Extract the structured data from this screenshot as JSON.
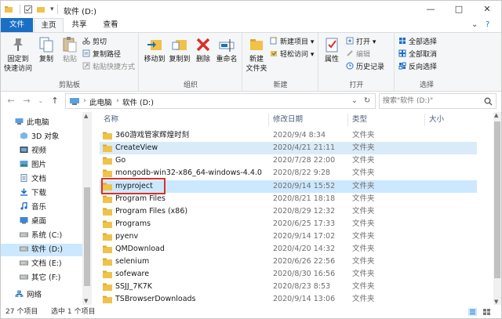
{
  "title": {
    "window_title": "软件 (D:)",
    "minimize": "—",
    "maximize": "□",
    "close": "✕"
  },
  "tabs": {
    "file": "文件",
    "home": "主页",
    "share": "共享",
    "view": "查看"
  },
  "ribbon": {
    "clipboard": {
      "pin": "固定到\n快速访问",
      "copy": "复制",
      "paste": "粘贴",
      "cut": "剪切",
      "copy_path": "复制路径",
      "paste_shortcut": "粘贴快捷方式",
      "label": "剪贴板"
    },
    "organize": {
      "move_to": "移动到",
      "copy_to": "复制到",
      "delete": "删除",
      "rename": "重命名",
      "label": "组织"
    },
    "new": {
      "new_folder": "新建\n文件夹",
      "new_item": "新建项目 ▾",
      "easy_access": "轻松访问 ▾",
      "label": "新建"
    },
    "open": {
      "properties": "属性",
      "open": "打开 ▾",
      "edit": "编辑",
      "history": "历史记录",
      "label": "打开"
    },
    "select": {
      "select_all": "全部选择",
      "select_none": "全部取消",
      "invert": "反向选择",
      "label": "选择"
    }
  },
  "address": {
    "crumb_pc": "此电脑",
    "crumb_drive": "软件 (D:)",
    "search_placeholder": "搜索\"软件 (D:)\""
  },
  "nav": [
    {
      "label": "此电脑",
      "icon": "pc-icon"
    },
    {
      "label": "3D 对象",
      "icon": "3d-icon"
    },
    {
      "label": "视频",
      "icon": "video-icon"
    },
    {
      "label": "图片",
      "icon": "picture-icon"
    },
    {
      "label": "文档",
      "icon": "document-icon"
    },
    {
      "label": "下载",
      "icon": "download-icon"
    },
    {
      "label": "音乐",
      "icon": "music-icon"
    },
    {
      "label": "桌面",
      "icon": "desktop-icon"
    },
    {
      "label": "系统 (C:)",
      "icon": "drive-icon"
    },
    {
      "label": "软件 (D:)",
      "icon": "drive-icon"
    },
    {
      "label": "文档 (E:)",
      "icon": "drive-icon"
    },
    {
      "label": "其它 (F:)",
      "icon": "drive-icon"
    },
    {
      "label": "网络",
      "icon": "network-icon"
    }
  ],
  "columns": {
    "name": "名称",
    "date": "修改日期",
    "type": "类型",
    "size": "大小"
  },
  "files": [
    {
      "name": "360游戏管家辉煌时刻",
      "date": "2020/9/4 8:34",
      "type": "文件夹"
    },
    {
      "name": "CreateView",
      "date": "2020/4/21 21:11",
      "type": "文件夹"
    },
    {
      "name": "Go",
      "date": "2020/7/28 22:00",
      "type": "文件夹"
    },
    {
      "name": "mongodb-win32-x86_64-windows-4.4.0",
      "date": "2020/8/22 9:28",
      "type": "文件夹"
    },
    {
      "name": "myproject",
      "date": "2020/9/14 15:52",
      "type": "文件夹"
    },
    {
      "name": "Program Files",
      "date": "2020/8/21 18:18",
      "type": "文件夹"
    },
    {
      "name": "Program Files (x86)",
      "date": "2020/8/29 12:32",
      "type": "文件夹"
    },
    {
      "name": "Programs",
      "date": "2020/6/25 17:33",
      "type": "文件夹"
    },
    {
      "name": "pyenv",
      "date": "2020/9/14 17:02",
      "type": "文件夹"
    },
    {
      "name": "QMDownload",
      "date": "2020/4/20 14:32",
      "type": "文件夹"
    },
    {
      "name": "selenium",
      "date": "2020/6/26 22:56",
      "type": "文件夹"
    },
    {
      "name": "sofeware",
      "date": "2020/8/30 16:56",
      "type": "文件夹"
    },
    {
      "name": "SSJJ_7K7K",
      "date": "2020/8/23 8:53",
      "type": "文件夹"
    },
    {
      "name": "TSBrowserDownloads",
      "date": "2020/9/14 13:06",
      "type": "文件夹"
    }
  ],
  "status": {
    "count": "27 个项目",
    "selected": "选中 1 个项目"
  },
  "colors": {
    "accent": "#1a6fc4",
    "folder": "#f0c24a",
    "selection": "#cce8ff",
    "highlight_box": "#d9302b"
  }
}
